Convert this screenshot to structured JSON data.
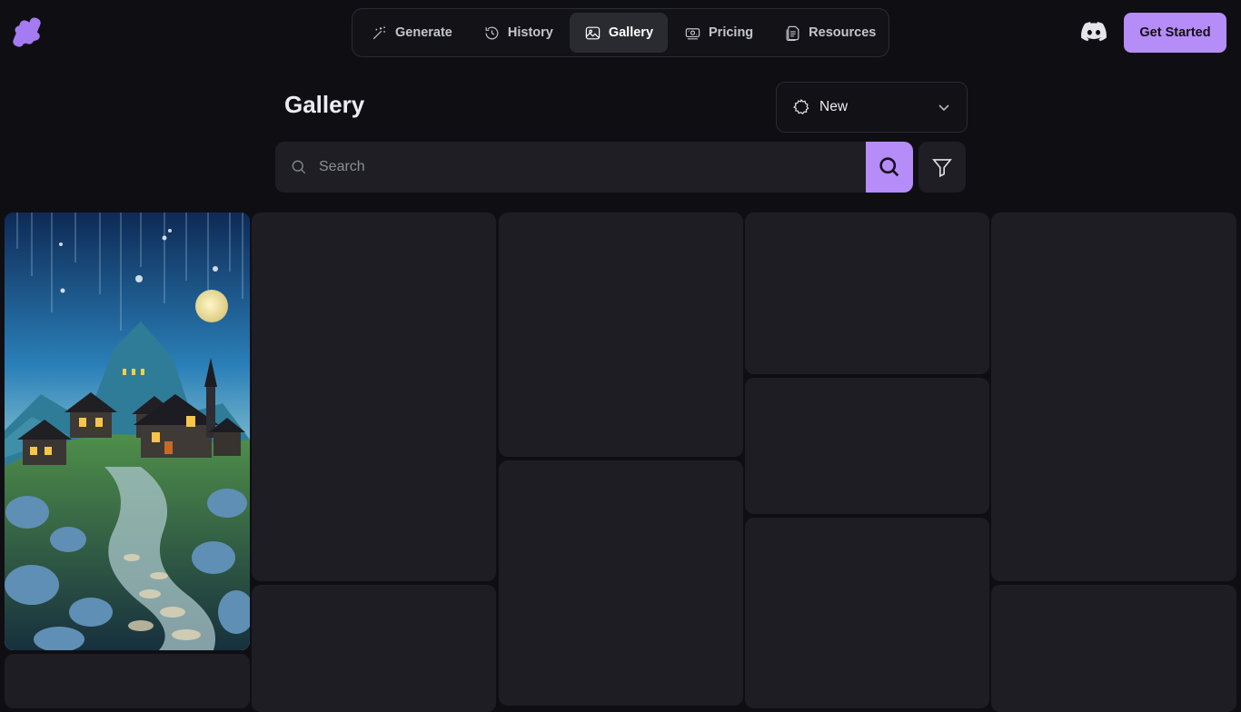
{
  "brand": {
    "logo_icon": "hash-logo-icon",
    "accent": "#b58cf8"
  },
  "nav": {
    "items": [
      {
        "label": "Generate",
        "icon": "magic-wand-icon"
      },
      {
        "label": "History",
        "icon": "history-clock-icon"
      },
      {
        "label": "Gallery",
        "icon": "image-icon",
        "active": true
      },
      {
        "label": "Pricing",
        "icon": "money-icon"
      },
      {
        "label": "Resources",
        "icon": "document-icon"
      }
    ]
  },
  "header": {
    "get_started_label": "Get Started",
    "discord_icon": "discord-icon"
  },
  "page": {
    "title": "Gallery"
  },
  "sort": {
    "selected": "New",
    "icon": "gear-icon"
  },
  "search": {
    "placeholder": "Search",
    "value": ""
  },
  "colors": {
    "background": "#0f0f13",
    "tile": "#1d1d23",
    "accent": "#b58cf8"
  }
}
